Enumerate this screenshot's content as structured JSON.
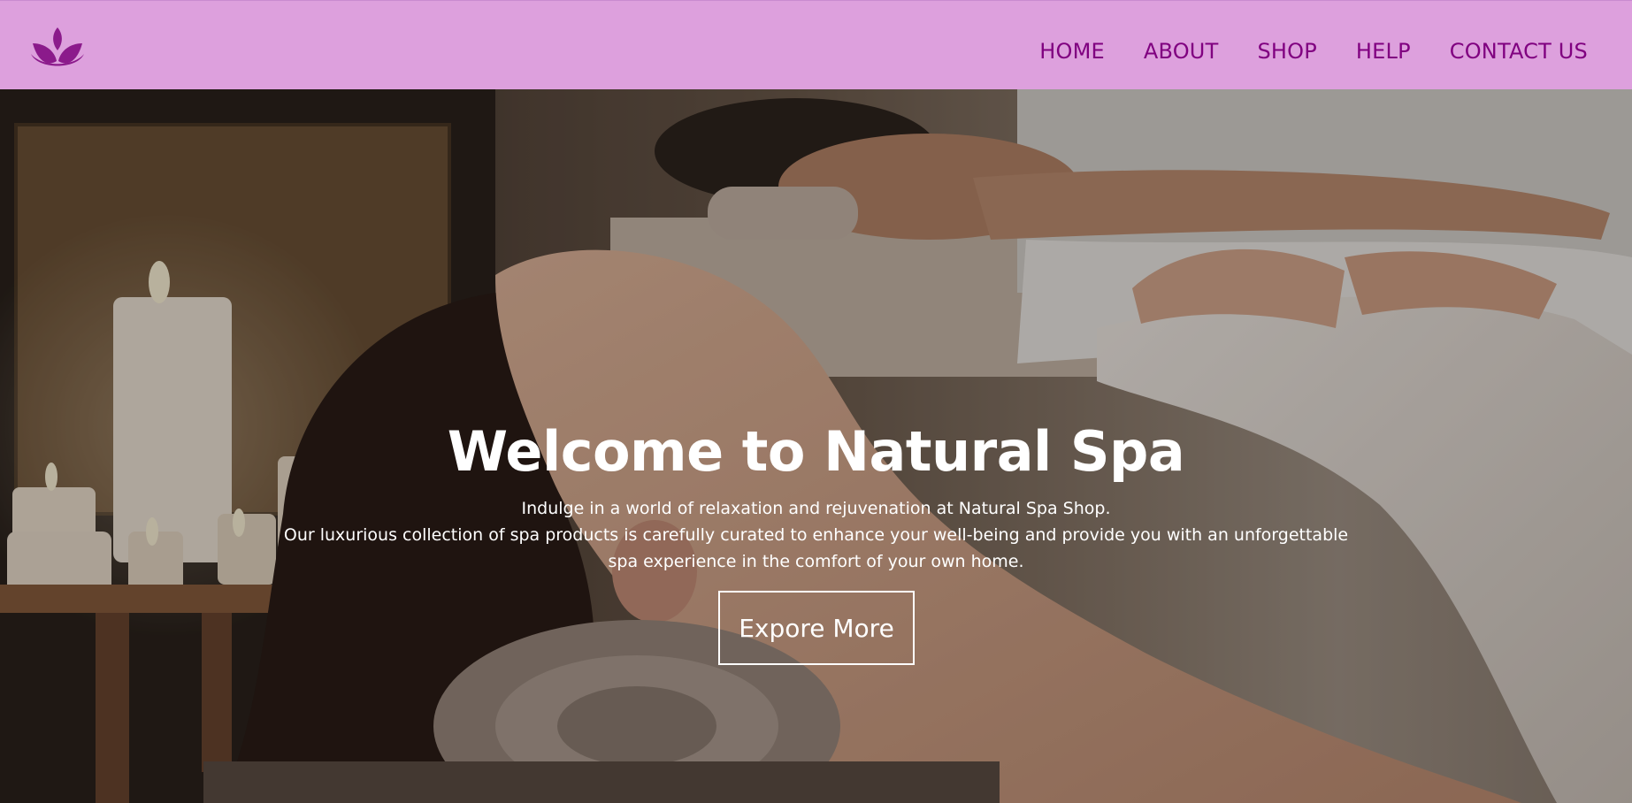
{
  "nav": {
    "logo_icon": "lotus-icon",
    "links": [
      "HOME",
      "ABOUT",
      "SHOP",
      "HELP",
      "CONTACT US"
    ]
  },
  "hero": {
    "title": "Welcome to Natural Spa",
    "lines": [
      "Indulge in a world of relaxation and rejuvenation at Natural Spa Shop.",
      "Our luxurious collection of spa products is carefully curated to enhance your well-being and provide you with an unforgettable",
      "spa experience in the comfort of your own home."
    ],
    "cta_label": "Expore More"
  },
  "colors": {
    "navbar_bg": "#dda0dd",
    "nav_text": "#800080",
    "logo": "#8b1a8b",
    "hero_text": "#ffffff"
  }
}
